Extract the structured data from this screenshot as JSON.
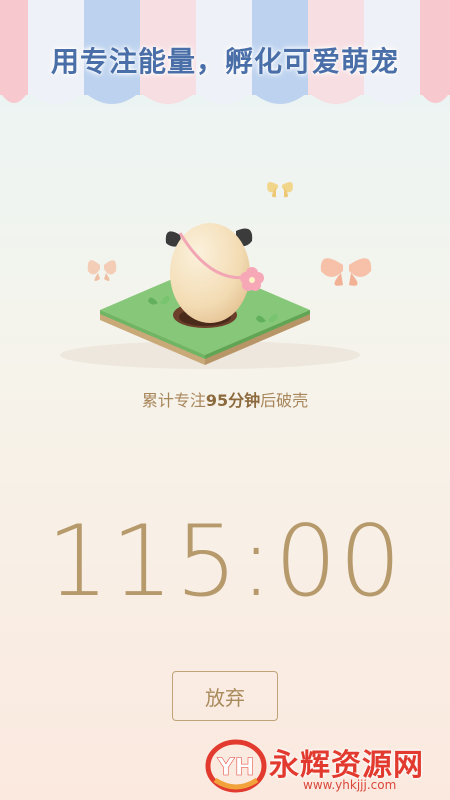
{
  "banner": {
    "title": "用专注能量，孵化可爱萌宠"
  },
  "pet": {
    "progress_prefix": "累计专注",
    "progress_value": "95",
    "progress_unit": "分钟",
    "progress_suffix": "后破壳"
  },
  "timer": {
    "display": "115:00"
  },
  "actions": {
    "give_up_label": "放弃"
  },
  "watermark": {
    "logo_text": "YH",
    "title": "永辉资源网",
    "url": "www.yhkjjj.com"
  },
  "colors": {
    "title": "#4a6fa8",
    "timer": "#b69a6c",
    "accent": "#a98a5c",
    "watermark": "#e23a2e"
  }
}
